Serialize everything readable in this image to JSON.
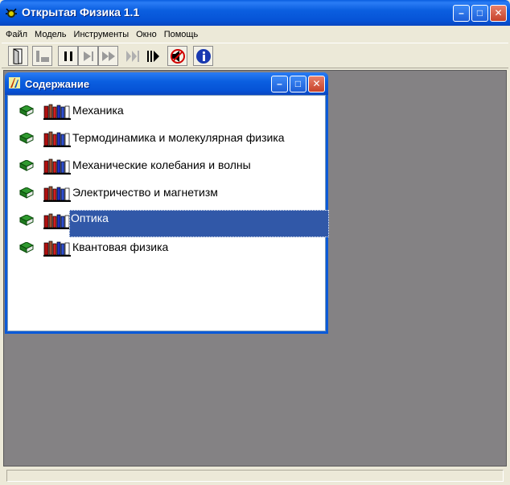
{
  "window": {
    "title": "Открытая Физика 1.1",
    "minimize_glyph": "–",
    "maximize_glyph": "□",
    "close_glyph": "✕"
  },
  "menu": [
    "Файл",
    "Модель",
    "Инструменты",
    "Окно",
    "Помощь"
  ],
  "toolbar": {
    "buttons": [
      {
        "name": "exit-door-icon",
        "enabled": true
      },
      {
        "name": "step-back-icon",
        "enabled": false
      },
      {
        "name": "pause-icon",
        "enabled": true
      },
      {
        "name": "step-forward-icon",
        "enabled": true
      },
      {
        "name": "fast-forward-icon",
        "enabled": true
      },
      {
        "name": "rewind-marks-icon",
        "enabled": false
      },
      {
        "name": "forward-marks-icon",
        "enabled": true
      },
      {
        "name": "sound-off-icon",
        "enabled": true
      },
      {
        "name": "info-icon",
        "enabled": true
      }
    ]
  },
  "contents_window": {
    "title": "Содержание",
    "items": [
      {
        "label": "Механика"
      },
      {
        "label": "Термодинамика и молекулярная физика"
      },
      {
        "label": "Механические колебания и волны"
      },
      {
        "label": "Электричество и магнетизм"
      },
      {
        "label": "Оптика",
        "selected": true
      },
      {
        "label": "Квантовая физика"
      }
    ]
  },
  "colors": {
    "titlebar": "#0b5fe0",
    "selection": "#3158a8",
    "mdi_background": "#848284"
  }
}
